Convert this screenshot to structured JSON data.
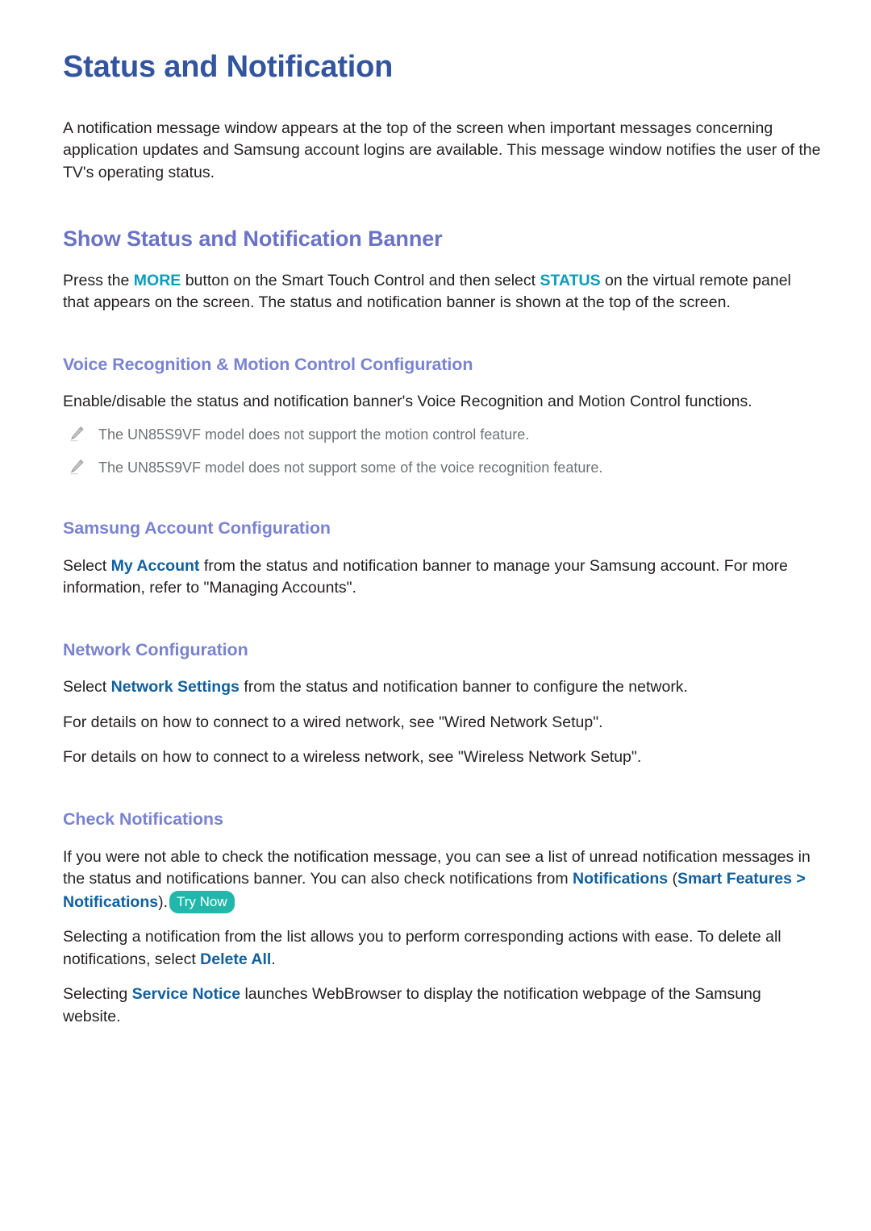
{
  "document": {
    "title": "Status and Notification",
    "intro": "A notification message window appears at the top of the screen when important messages concerning application updates and Samsung account logins are available. This message window notifies the user of the TV's operating status."
  },
  "colors": {
    "title_blue": "#33549e",
    "heading_periwinkle": "#6a73c6",
    "subheading_periwinkle": "#7a83d0",
    "link_blue": "#10609f",
    "keyword_teal": "#0c9cb9",
    "badge_teal": "#23b7ab",
    "body_text": "#231f20",
    "note_text": "#6f7375",
    "page_background": "#ffffff"
  },
  "sections": {
    "show_banner": {
      "heading": "Show Status and Notification Banner",
      "paragraph": {
        "part1": "Press the ",
        "kw1": "MORE",
        "part2": " button on the Smart Touch Control and then select ",
        "kw2": "STATUS",
        "part3": " on the virtual remote panel that appears on the screen. The status and notification banner is shown at the top of the screen."
      }
    },
    "voice_motion": {
      "heading": "Voice Recognition & Motion Control Configuration",
      "paragraph": "Enable/disable the status and notification banner's Voice Recognition and Motion Control functions.",
      "notes": [
        {
          "icon": "pencil-icon",
          "text": "The UN85S9VF model does not support the motion control feature."
        },
        {
          "icon": "pencil-icon",
          "text": "The UN85S9VF model does not support some of the voice recognition feature."
        }
      ]
    },
    "samsung_account": {
      "heading": "Samsung Account Configuration",
      "paragraph": {
        "part1": "Select ",
        "kw1": "My Account",
        "part2": " from the status and notification banner to manage your Samsung account. For more information, refer to \"Managing Accounts\"."
      }
    },
    "network": {
      "heading": "Network Configuration",
      "paragraph1": {
        "part1": "Select ",
        "kw1": "Network Settings",
        "part2": " from the status and notification banner to configure the network."
      },
      "paragraph2": "For details on how to connect to a wired network, see \"Wired Network Setup\".",
      "paragraph3": "For details on how to connect to a wireless network, see \"Wireless Network Setup\"."
    },
    "check_notifications": {
      "heading": "Check Notifications",
      "paragraph1": {
        "part1": "If you were not able to check the notification message, you can see a list of unread notification messages in the status and notifications banner. You can also check notifications from ",
        "kw1": "Notifications",
        "part2": " (",
        "kw2": "Smart Features",
        "part3": " > ",
        "kw3": "Notifications",
        "part4": ").",
        "badge": "Try Now"
      },
      "paragraph2": {
        "part1": "Selecting a notification from the list allows you to perform corresponding actions with ease. To delete all notifications, select ",
        "kw1": "Delete All",
        "part2": "."
      },
      "paragraph3": {
        "part1": "Selecting ",
        "kw1": "Service Notice",
        "part2": " launches WebBrowser to display the notification webpage of the Samsung website."
      }
    }
  }
}
